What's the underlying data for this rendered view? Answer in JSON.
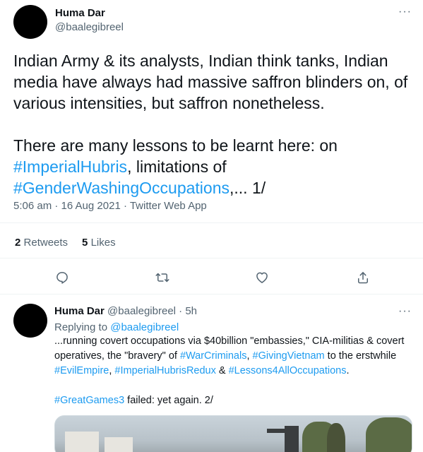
{
  "main_tweet": {
    "author_name": "Huma Dar",
    "author_handle": "@baalegibreel",
    "more_label": "···",
    "text": [
      {
        "t": "Indian Army & its analysts, Indian think tanks, Indian media have always had massive saffron blinders on, of various intensities, but saffron nonetheless.\n\nThere are many lessons to be learnt here: on ",
        "link": false
      },
      {
        "t": "#ImperialHubris",
        "link": true
      },
      {
        "t": ", limitations of\n",
        "link": false
      },
      {
        "t": "#GenderWashingOccupations",
        "link": true
      },
      {
        "t": ",... 1/",
        "link": false
      }
    ],
    "meta": "5:06 am · 16 Aug 2021 · Twitter Web App",
    "retweets_count": "2",
    "retweets_label": "Retweets",
    "likes_count": "5",
    "likes_label": "Likes"
  },
  "actions": [
    "reply-icon",
    "retweet-icon",
    "like-icon",
    "share-icon"
  ],
  "reply_tweet": {
    "author_name": "Huma Dar",
    "author_handle": "@baalegibreel",
    "time": "5h",
    "separator": "·",
    "more_label": "···",
    "replying_prefix": "Replying to",
    "replying_handle": "@baalegibreel",
    "text": [
      {
        "t": "...running covert occupations via $40billion \"embassies,\" CIA-militias & covert operatives, the \"bravery\" of ",
        "link": false
      },
      {
        "t": "#WarCriminals",
        "link": true
      },
      {
        "t": ", ",
        "link": false
      },
      {
        "t": "#GivingVietnam",
        "link": true
      },
      {
        "t": " to the erstwhile ",
        "link": false
      },
      {
        "t": "#EvilEmpire",
        "link": true
      },
      {
        "t": ", ",
        "link": false
      },
      {
        "t": "#ImperialHubrisRedux",
        "link": true
      },
      {
        "t": " & ",
        "link": false
      },
      {
        "t": "#Lessons4AllOccupations",
        "link": true
      },
      {
        "t": ".\n\n",
        "link": false
      },
      {
        "t": "#GreatGames3",
        "link": true
      },
      {
        "t": " failed: yet again. 2/",
        "link": false
      }
    ]
  },
  "colors": {
    "link": "#1d9bf0",
    "muted": "#536471",
    "text": "#0f1419"
  }
}
